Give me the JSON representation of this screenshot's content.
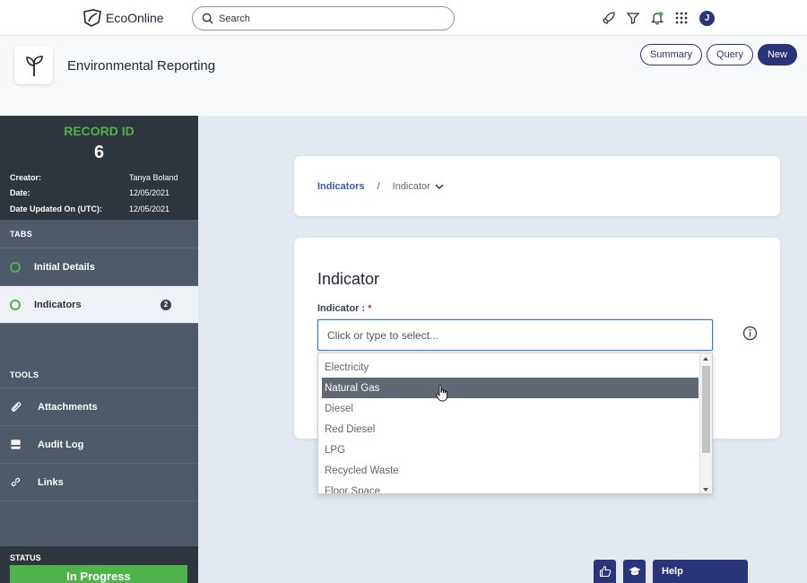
{
  "topbar": {
    "brand": "EcoOnline",
    "search_placeholder": "Search",
    "avatar_initial": "J"
  },
  "header": {
    "title": "Environmental Reporting",
    "buttons": {
      "summary": "Summary",
      "query": "Query",
      "new": "New"
    }
  },
  "record": {
    "label": "RECORD ID",
    "id": "6",
    "meta": [
      {
        "label": "Creator:",
        "value": "Tanya Boland"
      },
      {
        "label": "Date:",
        "value": "12/05/2021"
      },
      {
        "label": "Date Updated On (UTC):",
        "value": "12/05/2021"
      }
    ]
  },
  "sidebar": {
    "tabs_header": "TABS",
    "tabs": [
      {
        "label": "Initial Details"
      },
      {
        "label": "Indicators",
        "badge": "2"
      }
    ],
    "tools_header": "TOOLS",
    "tools": [
      {
        "label": "Attachments"
      },
      {
        "label": "Audit Log"
      },
      {
        "label": "Links"
      }
    ],
    "status_header": "STATUS",
    "status_value": "In Progress"
  },
  "breadcrumb": {
    "parent": "Indicators",
    "separator": "/",
    "current": "Indicator"
  },
  "form": {
    "title": "Indicator",
    "field_label": "Indicator :",
    "required_mark": "*",
    "placeholder": "Click or type to select..."
  },
  "dropdown": {
    "options": [
      "Electricity",
      "Natural Gas",
      "Diesel",
      "Red Diesel",
      "LPG",
      "Recycled Waste",
      "Floor Space"
    ],
    "highlighted": "Natural Gas"
  },
  "footer": {
    "help": "Help"
  },
  "colors": {
    "primary": "#2a3478",
    "success": "#4fb24c",
    "sidebar": "#4e5a67",
    "focus": "#3e7bd6"
  }
}
